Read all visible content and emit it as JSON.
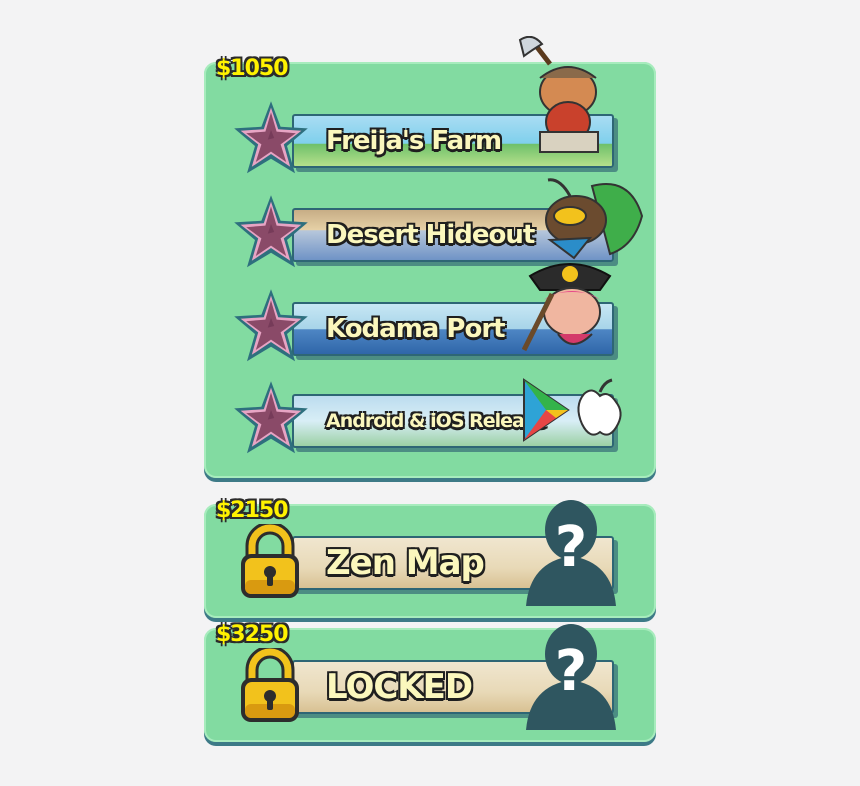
{
  "colors": {
    "panel": "#82dba1",
    "panel_shadow": "#3d7a87",
    "goal_text": "#fff200",
    "banner_text": "#fbf7bd",
    "star_fill": "#8a4a68",
    "lock_gold": "#f2c21c"
  },
  "groups": [
    {
      "goal": "$1050",
      "items": [
        {
          "label": "Freija's Farm",
          "icon": "star-icon",
          "character": "viking-warrior-icon"
        },
        {
          "label": "Desert Hideout",
          "icon": "star-icon",
          "character": "beetle-bandit-icon"
        },
        {
          "label": "Kodama Port",
          "icon": "star-icon",
          "character": "pirate-girl-icon"
        },
        {
          "label": "Android & iOS Release",
          "icon": "star-icon",
          "character": "app-store-logos-icon"
        }
      ]
    },
    {
      "goal": "$2150",
      "items": [
        {
          "label": "Zen Map",
          "icon": "lock-icon",
          "character": "mystery-silhouette-icon"
        }
      ]
    },
    {
      "goal": "$3250",
      "items": [
        {
          "label": "LOCKED",
          "icon": "lock-icon",
          "character": "mystery-silhouette-icon"
        }
      ]
    }
  ]
}
